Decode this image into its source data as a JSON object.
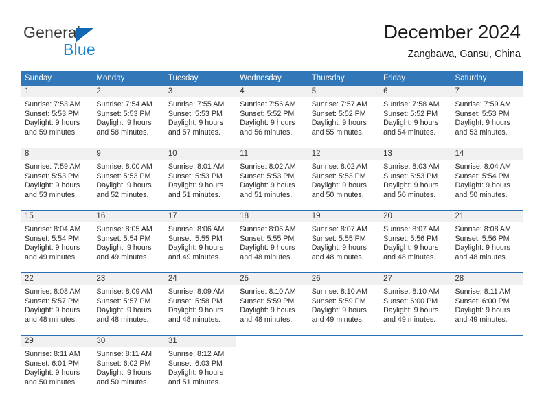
{
  "brand": {
    "name_top": "General",
    "name_bottom": "Blue",
    "accent_color": "#1268b3",
    "blue_text_color": "#1d86d4"
  },
  "header": {
    "title": "December 2024",
    "subtitle": "Zangbawa, Gansu, China"
  },
  "colors": {
    "header_row_bg": "#3277b8",
    "row_divider": "#2a6db0",
    "daynum_band_bg": "#f0f0f0",
    "page_bg": "#ffffff",
    "text": "#2b2b2b"
  },
  "weekdays": [
    "Sunday",
    "Monday",
    "Tuesday",
    "Wednesday",
    "Thursday",
    "Friday",
    "Saturday"
  ],
  "weeks": [
    [
      {
        "day": "1",
        "sunrise": "Sunrise: 7:53 AM",
        "sunset": "Sunset: 5:53 PM",
        "daylight1": "Daylight: 9 hours",
        "daylight2": "and 59 minutes."
      },
      {
        "day": "2",
        "sunrise": "Sunrise: 7:54 AM",
        "sunset": "Sunset: 5:53 PM",
        "daylight1": "Daylight: 9 hours",
        "daylight2": "and 58 minutes."
      },
      {
        "day": "3",
        "sunrise": "Sunrise: 7:55 AM",
        "sunset": "Sunset: 5:53 PM",
        "daylight1": "Daylight: 9 hours",
        "daylight2": "and 57 minutes."
      },
      {
        "day": "4",
        "sunrise": "Sunrise: 7:56 AM",
        "sunset": "Sunset: 5:52 PM",
        "daylight1": "Daylight: 9 hours",
        "daylight2": "and 56 minutes."
      },
      {
        "day": "5",
        "sunrise": "Sunrise: 7:57 AM",
        "sunset": "Sunset: 5:52 PM",
        "daylight1": "Daylight: 9 hours",
        "daylight2": "and 55 minutes."
      },
      {
        "day": "6",
        "sunrise": "Sunrise: 7:58 AM",
        "sunset": "Sunset: 5:52 PM",
        "daylight1": "Daylight: 9 hours",
        "daylight2": "and 54 minutes."
      },
      {
        "day": "7",
        "sunrise": "Sunrise: 7:59 AM",
        "sunset": "Sunset: 5:53 PM",
        "daylight1": "Daylight: 9 hours",
        "daylight2": "and 53 minutes."
      }
    ],
    [
      {
        "day": "8",
        "sunrise": "Sunrise: 7:59 AM",
        "sunset": "Sunset: 5:53 PM",
        "daylight1": "Daylight: 9 hours",
        "daylight2": "and 53 minutes."
      },
      {
        "day": "9",
        "sunrise": "Sunrise: 8:00 AM",
        "sunset": "Sunset: 5:53 PM",
        "daylight1": "Daylight: 9 hours",
        "daylight2": "and 52 minutes."
      },
      {
        "day": "10",
        "sunrise": "Sunrise: 8:01 AM",
        "sunset": "Sunset: 5:53 PM",
        "daylight1": "Daylight: 9 hours",
        "daylight2": "and 51 minutes."
      },
      {
        "day": "11",
        "sunrise": "Sunrise: 8:02 AM",
        "sunset": "Sunset: 5:53 PM",
        "daylight1": "Daylight: 9 hours",
        "daylight2": "and 51 minutes."
      },
      {
        "day": "12",
        "sunrise": "Sunrise: 8:02 AM",
        "sunset": "Sunset: 5:53 PM",
        "daylight1": "Daylight: 9 hours",
        "daylight2": "and 50 minutes."
      },
      {
        "day": "13",
        "sunrise": "Sunrise: 8:03 AM",
        "sunset": "Sunset: 5:53 PM",
        "daylight1": "Daylight: 9 hours",
        "daylight2": "and 50 minutes."
      },
      {
        "day": "14",
        "sunrise": "Sunrise: 8:04 AM",
        "sunset": "Sunset: 5:54 PM",
        "daylight1": "Daylight: 9 hours",
        "daylight2": "and 50 minutes."
      }
    ],
    [
      {
        "day": "15",
        "sunrise": "Sunrise: 8:04 AM",
        "sunset": "Sunset: 5:54 PM",
        "daylight1": "Daylight: 9 hours",
        "daylight2": "and 49 minutes."
      },
      {
        "day": "16",
        "sunrise": "Sunrise: 8:05 AM",
        "sunset": "Sunset: 5:54 PM",
        "daylight1": "Daylight: 9 hours",
        "daylight2": "and 49 minutes."
      },
      {
        "day": "17",
        "sunrise": "Sunrise: 8:06 AM",
        "sunset": "Sunset: 5:55 PM",
        "daylight1": "Daylight: 9 hours",
        "daylight2": "and 49 minutes."
      },
      {
        "day": "18",
        "sunrise": "Sunrise: 8:06 AM",
        "sunset": "Sunset: 5:55 PM",
        "daylight1": "Daylight: 9 hours",
        "daylight2": "and 48 minutes."
      },
      {
        "day": "19",
        "sunrise": "Sunrise: 8:07 AM",
        "sunset": "Sunset: 5:55 PM",
        "daylight1": "Daylight: 9 hours",
        "daylight2": "and 48 minutes."
      },
      {
        "day": "20",
        "sunrise": "Sunrise: 8:07 AM",
        "sunset": "Sunset: 5:56 PM",
        "daylight1": "Daylight: 9 hours",
        "daylight2": "and 48 minutes."
      },
      {
        "day": "21",
        "sunrise": "Sunrise: 8:08 AM",
        "sunset": "Sunset: 5:56 PM",
        "daylight1": "Daylight: 9 hours",
        "daylight2": "and 48 minutes."
      }
    ],
    [
      {
        "day": "22",
        "sunrise": "Sunrise: 8:08 AM",
        "sunset": "Sunset: 5:57 PM",
        "daylight1": "Daylight: 9 hours",
        "daylight2": "and 48 minutes."
      },
      {
        "day": "23",
        "sunrise": "Sunrise: 8:09 AM",
        "sunset": "Sunset: 5:57 PM",
        "daylight1": "Daylight: 9 hours",
        "daylight2": "and 48 minutes."
      },
      {
        "day": "24",
        "sunrise": "Sunrise: 8:09 AM",
        "sunset": "Sunset: 5:58 PM",
        "daylight1": "Daylight: 9 hours",
        "daylight2": "and 48 minutes."
      },
      {
        "day": "25",
        "sunrise": "Sunrise: 8:10 AM",
        "sunset": "Sunset: 5:59 PM",
        "daylight1": "Daylight: 9 hours",
        "daylight2": "and 48 minutes."
      },
      {
        "day": "26",
        "sunrise": "Sunrise: 8:10 AM",
        "sunset": "Sunset: 5:59 PM",
        "daylight1": "Daylight: 9 hours",
        "daylight2": "and 49 minutes."
      },
      {
        "day": "27",
        "sunrise": "Sunrise: 8:10 AM",
        "sunset": "Sunset: 6:00 PM",
        "daylight1": "Daylight: 9 hours",
        "daylight2": "and 49 minutes."
      },
      {
        "day": "28",
        "sunrise": "Sunrise: 8:11 AM",
        "sunset": "Sunset: 6:00 PM",
        "daylight1": "Daylight: 9 hours",
        "daylight2": "and 49 minutes."
      }
    ],
    [
      {
        "day": "29",
        "sunrise": "Sunrise: 8:11 AM",
        "sunset": "Sunset: 6:01 PM",
        "daylight1": "Daylight: 9 hours",
        "daylight2": "and 50 minutes."
      },
      {
        "day": "30",
        "sunrise": "Sunrise: 8:11 AM",
        "sunset": "Sunset: 6:02 PM",
        "daylight1": "Daylight: 9 hours",
        "daylight2": "and 50 minutes."
      },
      {
        "day": "31",
        "sunrise": "Sunrise: 8:12 AM",
        "sunset": "Sunset: 6:03 PM",
        "daylight1": "Daylight: 9 hours",
        "daylight2": "and 51 minutes."
      },
      {
        "day": "",
        "sunrise": "",
        "sunset": "",
        "daylight1": "",
        "daylight2": ""
      },
      {
        "day": "",
        "sunrise": "",
        "sunset": "",
        "daylight1": "",
        "daylight2": ""
      },
      {
        "day": "",
        "sunrise": "",
        "sunset": "",
        "daylight1": "",
        "daylight2": ""
      },
      {
        "day": "",
        "sunrise": "",
        "sunset": "",
        "daylight1": "",
        "daylight2": ""
      }
    ]
  ]
}
